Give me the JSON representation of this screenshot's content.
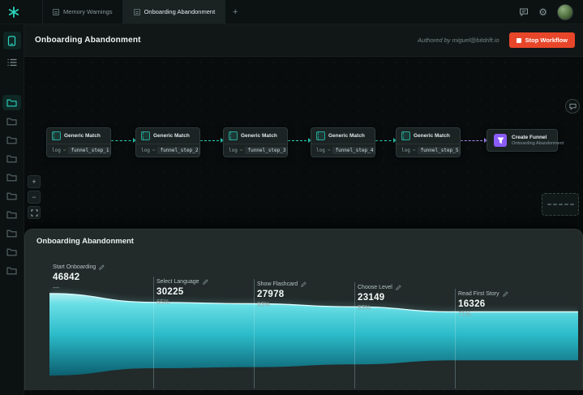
{
  "topbar": {
    "tabs": [
      {
        "label": "Memory Warnings"
      },
      {
        "label": "Onboarding Abandonment"
      }
    ],
    "new_tab": "+"
  },
  "icons": {
    "gear_glyph": "⚙",
    "match_glyph": "( )",
    "zoom_in": "+",
    "zoom_out": "−"
  },
  "header": {
    "title": "Onboarding Abandonment",
    "authored_by": "Authored by miguel@bitdrift.io",
    "stop_button": "Stop Workflow"
  },
  "workflow": {
    "match_nodes": [
      {
        "title": "Generic Match",
        "field": "log",
        "op": "=",
        "value": "funnel_step_1"
      },
      {
        "title": "Generic Match",
        "field": "log",
        "op": "=",
        "value": "funnel_step_2"
      },
      {
        "title": "Generic Match",
        "field": "log",
        "op": "=",
        "value": "funnel_step_3"
      },
      {
        "title": "Generic Match",
        "field": "log",
        "op": "=",
        "value": "funnel_step_4"
      },
      {
        "title": "Generic Match",
        "field": "log",
        "op": "=",
        "value": "funnel_step_5"
      }
    ],
    "output_node": {
      "title": "Create Funnel",
      "subtitle": "Onboarding Abandonment"
    }
  },
  "panel": {
    "title": "Onboarding Abandonment",
    "stages": [
      {
        "label": "Start Onboarding",
        "value": "46842",
        "pct": "—"
      },
      {
        "label": "Select Language",
        "value": "30225",
        "pct": "65%"
      },
      {
        "label": "Show Flashcard",
        "value": "27978",
        "pct": "93%"
      },
      {
        "label": "Choose Level",
        "value": "23149",
        "pct": "83%"
      },
      {
        "label": "Read First Story",
        "value": "16326",
        "pct": "71%"
      }
    ]
  },
  "chart_data": {
    "type": "area",
    "title": "Onboarding Abandonment",
    "categories": [
      "Start Onboarding",
      "Select Language",
      "Show Flashcard",
      "Choose Level",
      "Read First Story"
    ],
    "values": [
      46842,
      30225,
      27978,
      23149,
      16326
    ],
    "conversion_pct_from_previous": [
      null,
      65,
      93,
      83,
      71
    ],
    "ylim": [
      0,
      46842
    ],
    "legend": false,
    "grid": "vertical-stage-dividers"
  },
  "sidebar": {
    "folder_count": 10
  },
  "colors": {
    "accent_teal": "#2dd4bf",
    "accent_purple": "#8b5cf6",
    "stop_red": "#e8462a",
    "funnel_top": "#b9f8fa",
    "funnel_bottom": "#0b6374"
  }
}
